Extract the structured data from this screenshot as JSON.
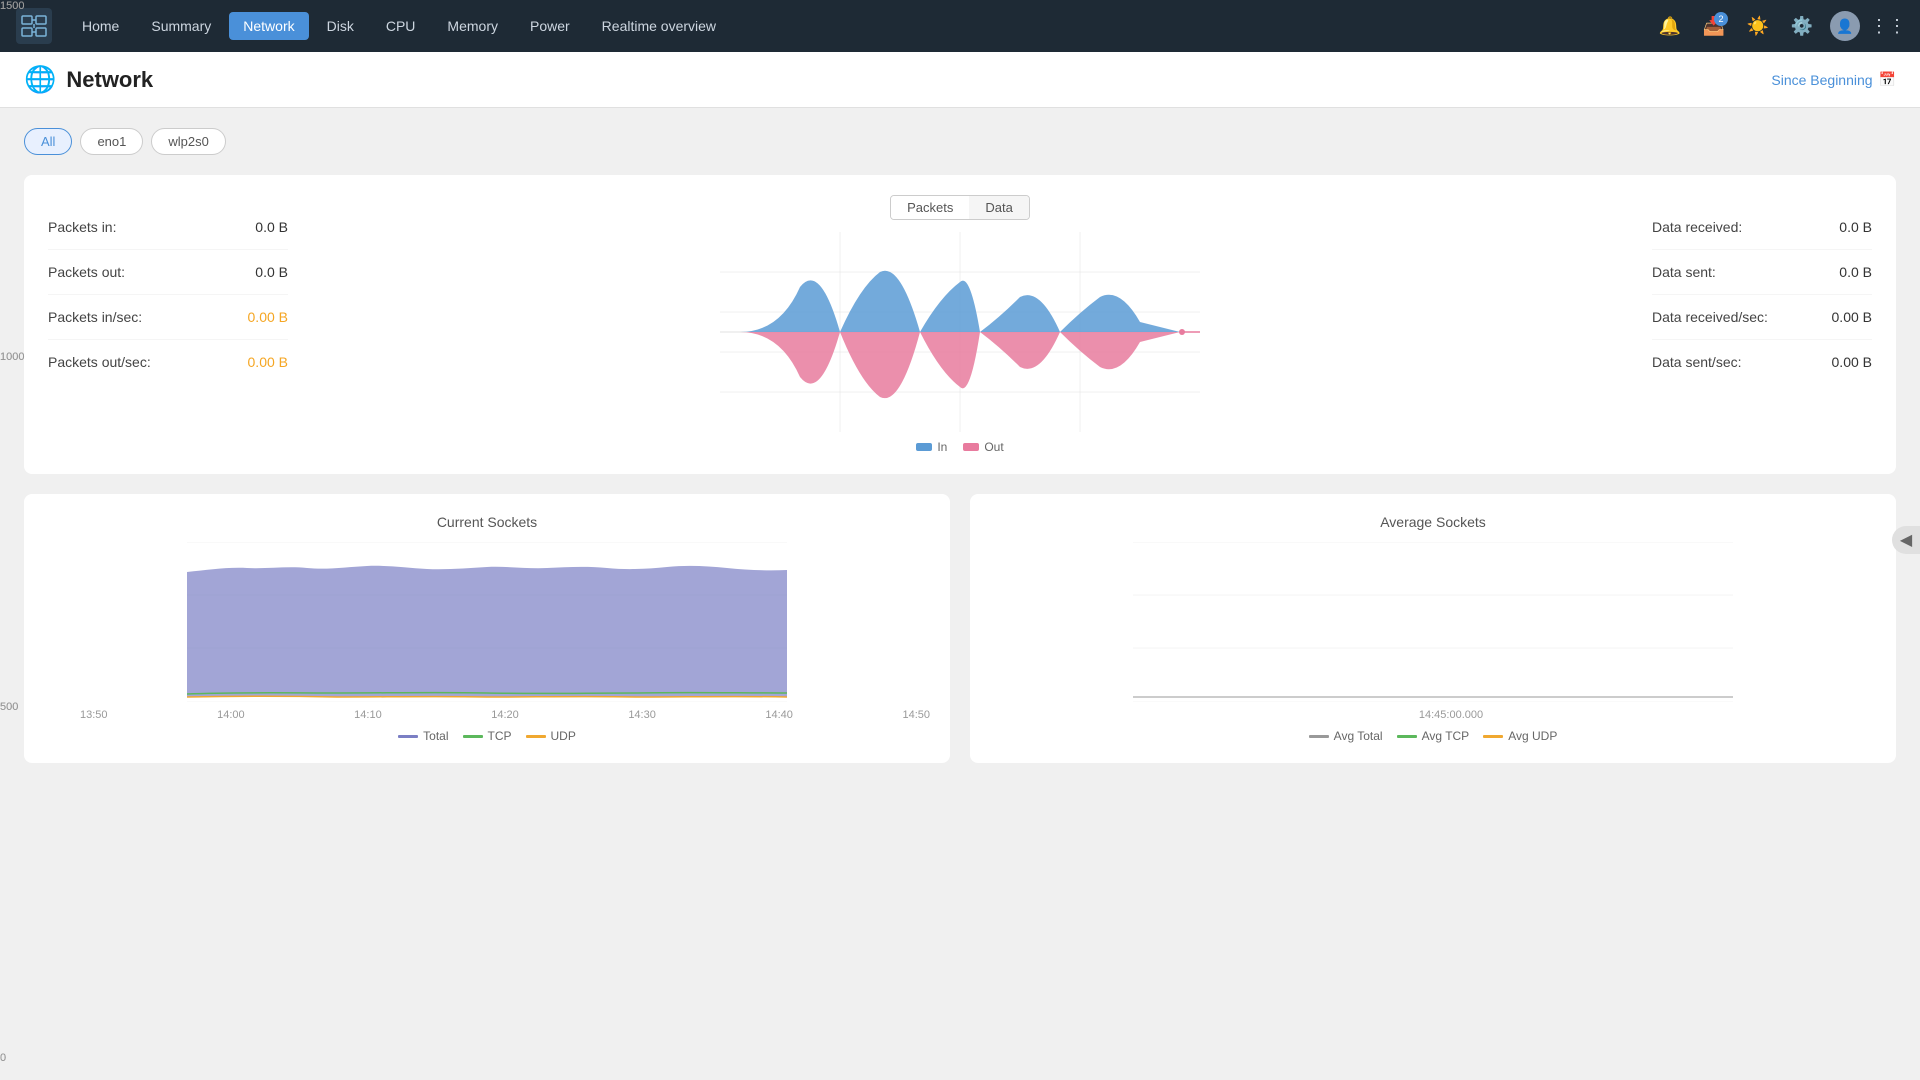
{
  "navbar": {
    "items": [
      {
        "id": "home",
        "label": "Home",
        "active": false
      },
      {
        "id": "summary",
        "label": "Summary",
        "active": false
      },
      {
        "id": "network",
        "label": "Network",
        "active": true
      },
      {
        "id": "disk",
        "label": "Disk",
        "active": false
      },
      {
        "id": "cpu",
        "label": "CPU",
        "active": false
      },
      {
        "id": "memory",
        "label": "Memory",
        "active": false
      },
      {
        "id": "power",
        "label": "Power",
        "active": false
      },
      {
        "id": "realtime",
        "label": "Realtime overview",
        "active": false
      }
    ],
    "badge_count": "2"
  },
  "page_header": {
    "title": "Network",
    "since_label": "Since Beginning"
  },
  "interface_tabs": [
    {
      "id": "all",
      "label": "All",
      "active": true
    },
    {
      "id": "eno1",
      "label": "eno1",
      "active": false
    },
    {
      "id": "wlp2s0",
      "label": "wlp2s0",
      "active": false
    }
  ],
  "toggle": {
    "packets_label": "Packets",
    "data_label": "Data"
  },
  "stats_left": [
    {
      "label": "Packets in:",
      "value": "0.0 B",
      "highlight": false
    },
    {
      "label": "Packets out:",
      "value": "0.0 B",
      "highlight": false
    },
    {
      "label": "Packets in/sec:",
      "value": "0.00 B",
      "highlight": true
    },
    {
      "label": "Packets out/sec:",
      "value": "0.00 B",
      "highlight": true
    }
  ],
  "stats_right": [
    {
      "label": "Data received:",
      "value": "0.0 B",
      "highlight": false
    },
    {
      "label": "Data sent:",
      "value": "0.0 B",
      "highlight": false
    },
    {
      "label": "Data received/sec:",
      "value": "0.00 B",
      "highlight": false
    },
    {
      "label": "Data sent/sec:",
      "value": "0.00 B",
      "highlight": false
    }
  ],
  "legend": {
    "in_label": "In",
    "out_label": "Out",
    "in_color": "#5b9bd5",
    "out_color": "#e87b9e"
  },
  "current_sockets": {
    "title": "Current Sockets",
    "y_labels": [
      "1500",
      "1000",
      "500",
      "0"
    ],
    "x_labels": [
      "13:50",
      "14:00",
      "14:10",
      "14:20",
      "14:30",
      "14:40",
      "14:50"
    ],
    "legend_items": [
      {
        "label": "Total",
        "color": "#7b7fc4"
      },
      {
        "label": "TCP",
        "color": "#5cb85c"
      },
      {
        "label": "UDP",
        "color": "#f0a830"
      }
    ]
  },
  "average_sockets": {
    "title": "Average Sockets",
    "y_labels": [
      "1500",
      "1000",
      "500",
      "0"
    ],
    "x_label": "14:45:00.000",
    "legend_items": [
      {
        "label": "Avg Total",
        "color": "#999"
      },
      {
        "label": "Avg TCP",
        "color": "#5cb85c"
      },
      {
        "label": "Avg UDP",
        "color": "#f0a830"
      }
    ]
  }
}
